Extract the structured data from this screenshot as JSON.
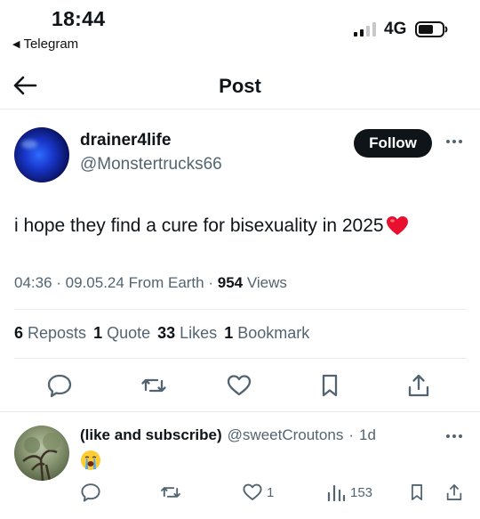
{
  "status_bar": {
    "time": "18:44",
    "back_app": "Telegram",
    "network": "4G"
  },
  "nav": {
    "title": "Post"
  },
  "post": {
    "display_name": "drainer4life",
    "handle": "@Monstertrucks66",
    "follow_label": "Follow",
    "text": "i hope they find a cure for bisexuality in 2025",
    "emoji": "red-heart",
    "time": "04:36",
    "date": "09.05.24",
    "source": "From Earth",
    "views_count": "954",
    "views_label": "Views",
    "stats": [
      {
        "count": "6",
        "label": "Reposts"
      },
      {
        "count": "1",
        "label": "Quote"
      },
      {
        "count": "33",
        "label": "Likes"
      },
      {
        "count": "1",
        "label": "Bookmark"
      }
    ]
  },
  "reply": {
    "display_name": "(like and subscribe)",
    "handle": "@sweetCroutons",
    "age": "1d",
    "emoji": "loudly-crying-face",
    "likes": "1",
    "views": "153"
  },
  "colors": {
    "text": "#0f1419",
    "secondary": "#536471",
    "divider": "#e7e9ea",
    "heart": "#e0245e"
  }
}
